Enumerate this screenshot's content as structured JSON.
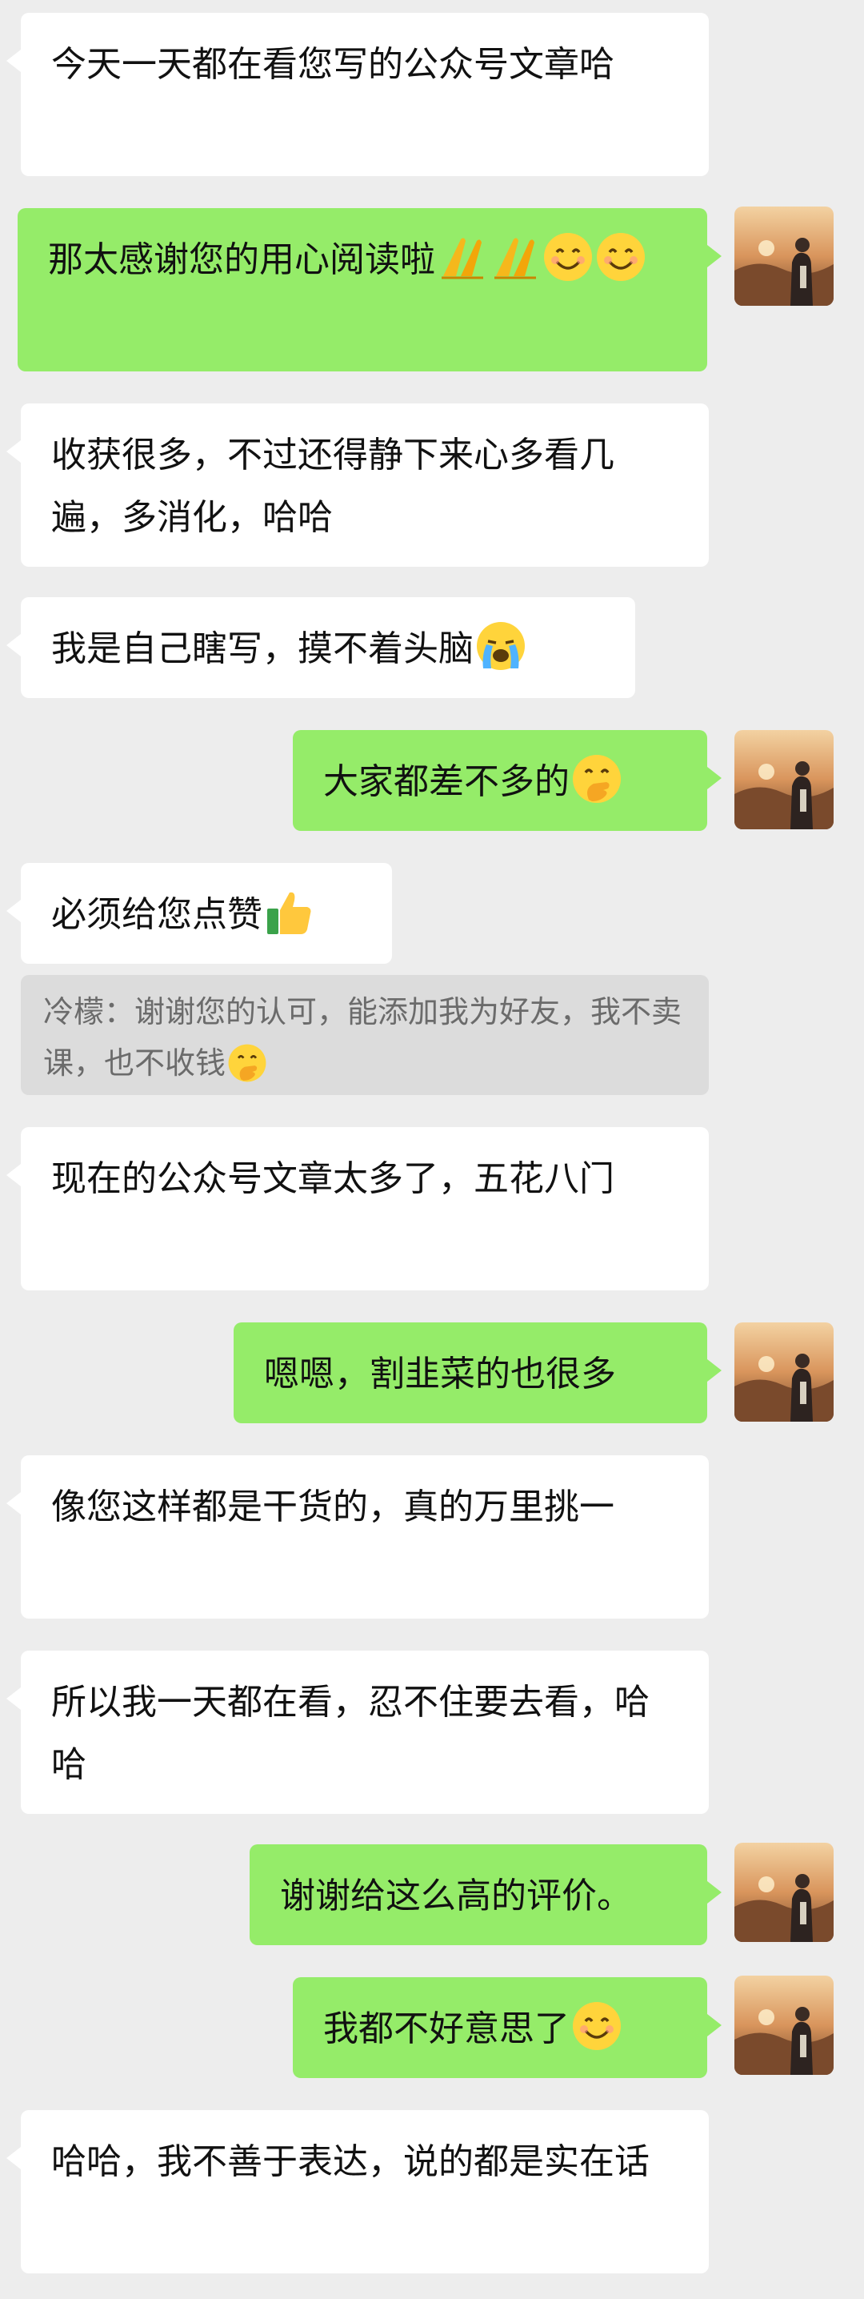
{
  "messages": [
    {
      "side": "in",
      "text": "今天一天都在看您写的公众号文章哈",
      "emojis": []
    },
    {
      "side": "out",
      "text": "那太感谢您的用心阅读啦",
      "emojis": [
        "clap-hands-emoji",
        "clap-hands-emoji",
        "smile-emoji",
        "smile-emoji"
      ]
    },
    {
      "side": "in",
      "text": "收获很多，不过还得静下来心多看几遍，多消化，哈哈",
      "emojis": []
    },
    {
      "side": "in",
      "text": "我是自己瞎写，摸不着头脑",
      "emojis": [
        "loudly-crying-emoji"
      ]
    },
    {
      "side": "out",
      "text": "大家都差不多的",
      "emojis": [
        "hand-over-mouth-emoji"
      ]
    },
    {
      "side": "in",
      "text": "必须给您点赞",
      "emojis": [
        "thumbs-up-emoji"
      ]
    },
    {
      "side": "in",
      "text": "现在的公众号文章太多了，五花八门",
      "emojis": []
    },
    {
      "side": "out",
      "text": "嗯嗯，割韭菜的也很多",
      "emojis": []
    },
    {
      "side": "in",
      "text": "像您这样都是干货的，真的万里挑一",
      "emojis": []
    },
    {
      "side": "in",
      "text": "所以我一天都在看，忍不住要去看，哈哈",
      "emojis": []
    },
    {
      "side": "out",
      "text": "谢谢给这么高的评价。",
      "emojis": []
    },
    {
      "side": "out",
      "text": "我都不好意思了",
      "emojis": [
        "smile-emoji"
      ]
    },
    {
      "side": "in",
      "text": "哈哈，我不善于表达，说的都是实在话",
      "emojis": []
    }
  ],
  "quote": {
    "author": "冷檬",
    "text": "谢谢您的认可，能添加我为好友，我不卖课，也不收钱",
    "emojis": [
      "hand-over-mouth-emoji"
    ]
  },
  "colors": {
    "background": "#ededed",
    "incoming_bubble": "#ffffff",
    "outgoing_bubble": "#95ec69",
    "quote_bubble": "#dcdcdc"
  }
}
